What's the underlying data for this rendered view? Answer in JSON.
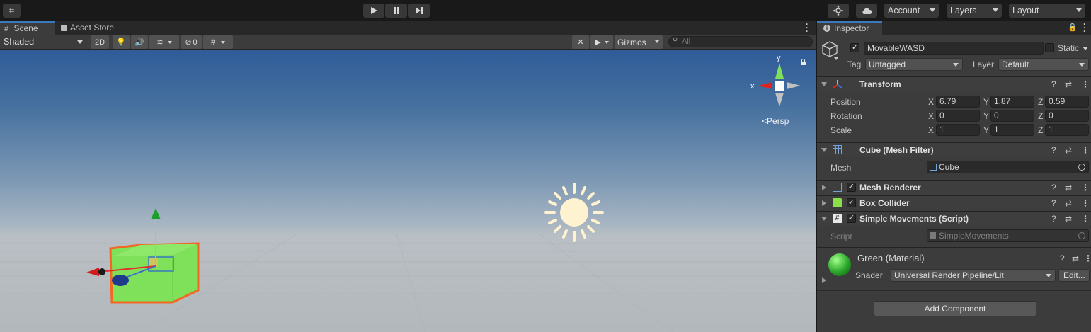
{
  "toolbar": {
    "account_label": "Account",
    "layers_label": "Layers",
    "layout_label": "Layout"
  },
  "scene": {
    "tabs": [
      {
        "label": "Scene"
      },
      {
        "label": "Asset Store"
      }
    ],
    "shading_mode": "Shaded",
    "mode_2d": "2D",
    "hidden_count": "0",
    "gizmos_label": "Gizmos",
    "search_placeholder": "All",
    "orientation": {
      "x_label": "x",
      "y_label": "y",
      "projection": "Persp"
    }
  },
  "inspector": {
    "tab_label": "Inspector",
    "object_name": "MovableWASD",
    "active": true,
    "static_label": "Static",
    "tag_label": "Tag",
    "tag_value": "Untagged",
    "layer_label": "Layer",
    "layer_value": "Default",
    "transform": {
      "title": "Transform",
      "position_label": "Position",
      "rotation_label": "Rotation",
      "scale_label": "Scale",
      "position": {
        "x": "6.79",
        "y": "1.87",
        "z": "0.59"
      },
      "rotation": {
        "x": "0",
        "y": "0",
        "z": "0"
      },
      "scale": {
        "x": "1",
        "y": "1",
        "z": "1"
      }
    },
    "mesh_filter": {
      "title": "Cube (Mesh Filter)",
      "mesh_label": "Mesh",
      "mesh_value": "Cube"
    },
    "mesh_renderer": {
      "title": "Mesh Renderer"
    },
    "box_collider": {
      "title": "Box Collider"
    },
    "script_comp": {
      "title": "Simple Movements (Script)",
      "script_label": "Script",
      "script_value": "SimpleMovements"
    },
    "material": {
      "title": "Green (Material)",
      "shader_label": "Shader",
      "shader_value": "Universal Render Pipeline/Lit",
      "edit_label": "Edit..."
    },
    "add_component_label": "Add Component"
  },
  "colors": {
    "accent": "#3a79bb",
    "selection_outline": "#f26722",
    "cube_green": "#7fe05a"
  }
}
